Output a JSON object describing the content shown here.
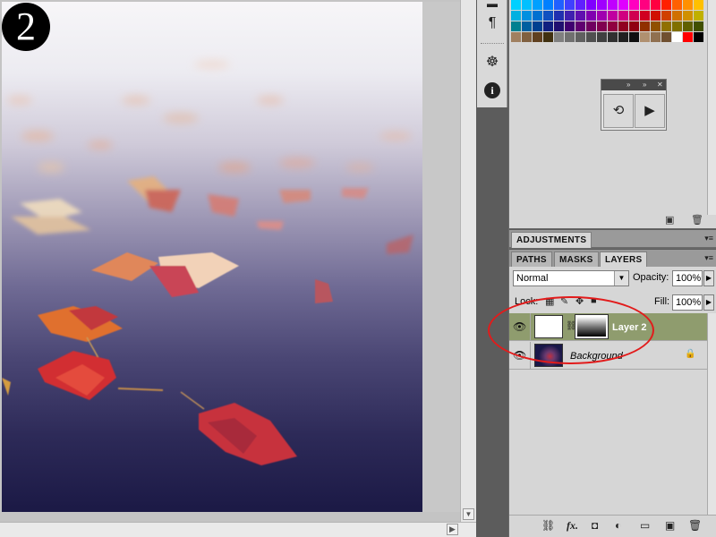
{
  "step_badge": "2",
  "swatch_colors": [
    "#00d0ff",
    "#00c0ff",
    "#00a0ff",
    "#0080ff",
    "#2060ff",
    "#4040ff",
    "#6020ff",
    "#8000ff",
    "#a000ff",
    "#c000ff",
    "#e000ff",
    "#ff00c0",
    "#ff0080",
    "#ff0040",
    "#ff2000",
    "#ff6000",
    "#ff9000",
    "#ffc000",
    "#00b0e0",
    "#0090e0",
    "#0070d0",
    "#1050c0",
    "#2030b0",
    "#4020b0",
    "#6010b0",
    "#8000b0",
    "#a000b0",
    "#c000a0",
    "#d00080",
    "#d00050",
    "#d00020",
    "#d01000",
    "#d04000",
    "#d07000",
    "#d09000",
    "#c0b000",
    "#008090",
    "#0060a0",
    "#004090",
    "#102080",
    "#201070",
    "#400070",
    "#600070",
    "#700060",
    "#800050",
    "#900040",
    "#900020",
    "#900010",
    "#903000",
    "#905000",
    "#907000",
    "#807000",
    "#606000",
    "#405000",
    "#a08060",
    "#806040",
    "#604020",
    "#403010",
    "#808080",
    "#707070",
    "#606060",
    "#505050",
    "#404040",
    "#303030",
    "#202020",
    "#101010",
    "#b09070",
    "#907050",
    "#705030",
    "#ffffff",
    "#ff0000",
    "#000000"
  ],
  "dock": {
    "paragraph_glyph": "¶",
    "navigator_glyph": "☸",
    "info_glyph": "i"
  },
  "panels": {
    "adjustments_tab": "ADJUSTMENTS",
    "paths_tab": "PATHS",
    "masks_tab": "MASKS",
    "layers_tab": "LAYERS"
  },
  "layers": {
    "blend_mode": "Normal",
    "opacity_label": "Opacity:",
    "opacity_value": "100%",
    "lock_label": "Lock:",
    "fill_label": "Fill:",
    "fill_value": "100%",
    "items": [
      {
        "name": "Layer 2",
        "selected": true
      },
      {
        "name": "Background",
        "selected": false,
        "locked": true
      }
    ]
  }
}
